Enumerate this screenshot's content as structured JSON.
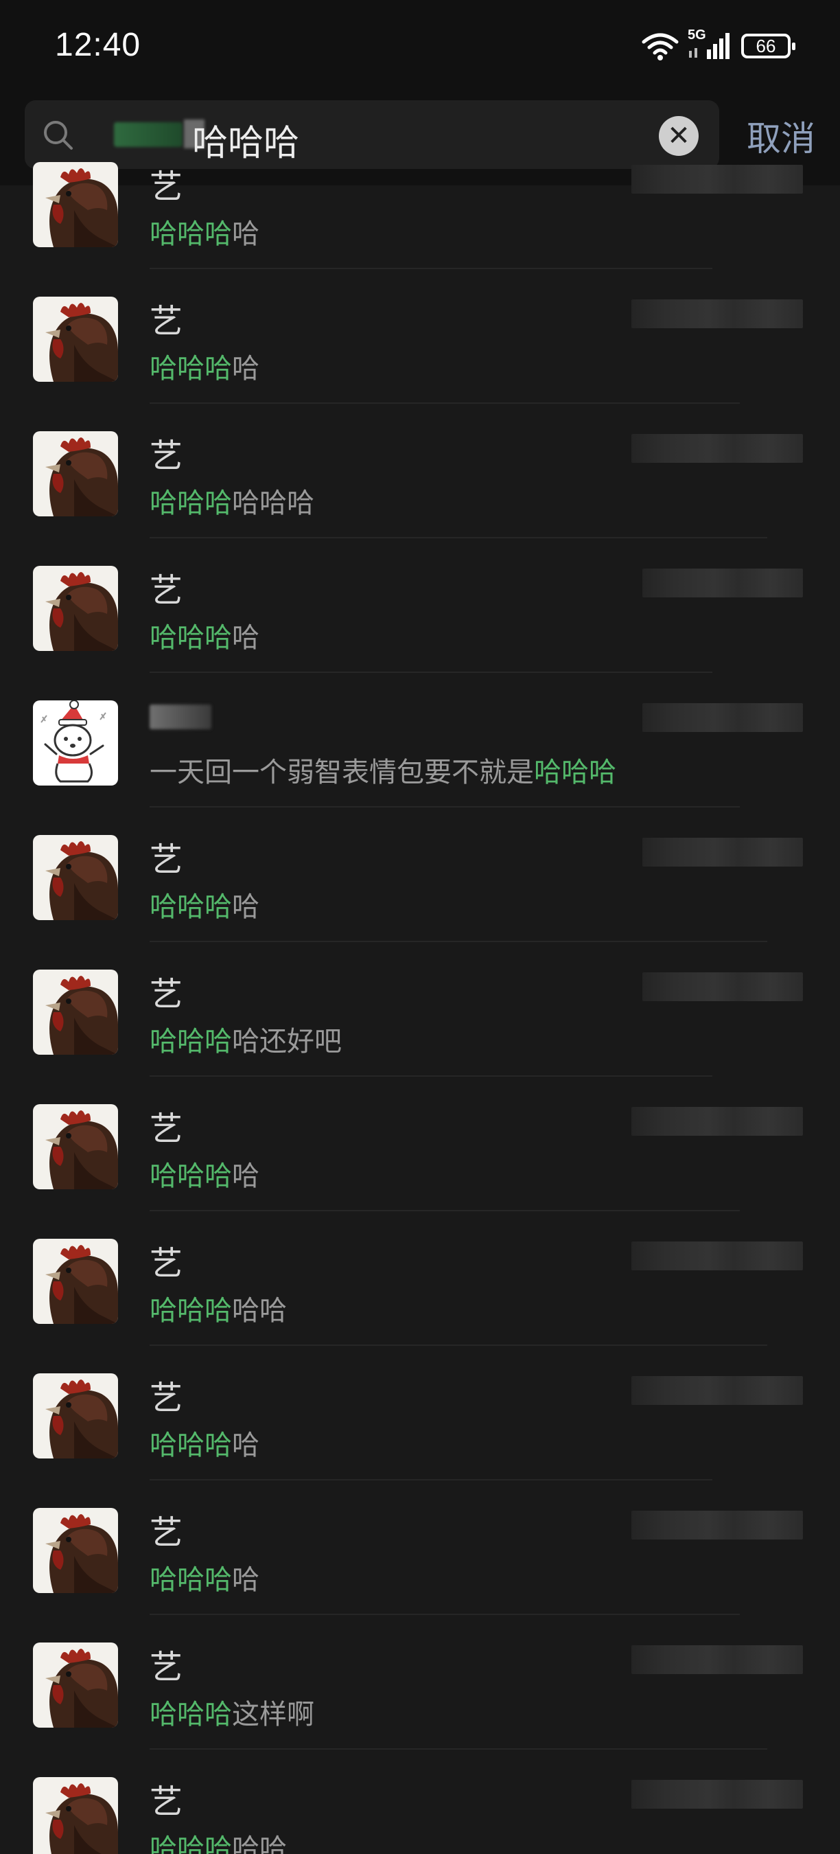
{
  "status_bar": {
    "time": "12:40",
    "network": "5G",
    "battery": "66"
  },
  "search": {
    "query": "哈哈哈",
    "cancel_label": "取消"
  },
  "results": [
    {
      "sender": "艺",
      "highlight": "哈哈哈",
      "rest": "哈"
    },
    {
      "sender": "艺",
      "highlight": "哈哈哈",
      "rest": "哈"
    },
    {
      "sender": "艺",
      "highlight": "哈哈哈",
      "rest": "哈哈哈"
    },
    {
      "sender": "艺",
      "highlight": "哈哈哈",
      "rest": "哈"
    },
    {
      "sender": "",
      "prefix": "一天回一个弱智表情包要不就是",
      "highlight": "哈哈哈",
      "rest": "",
      "avatar": "bear"
    },
    {
      "sender": "艺",
      "highlight": "哈哈哈",
      "rest": "哈"
    },
    {
      "sender": "艺",
      "highlight": "哈哈哈",
      "rest": "哈还好吧"
    },
    {
      "sender": "艺",
      "highlight": "哈哈哈",
      "rest": "哈"
    },
    {
      "sender": "艺",
      "highlight": "哈哈哈",
      "rest": "哈哈"
    },
    {
      "sender": "艺",
      "highlight": "哈哈哈",
      "rest": "哈"
    },
    {
      "sender": "艺",
      "highlight": "哈哈哈",
      "rest": "哈"
    },
    {
      "sender": "艺",
      "highlight": "哈哈哈",
      "rest": "这样啊"
    },
    {
      "sender": "艺",
      "highlight": "哈哈哈",
      "rest": "哈哈"
    }
  ],
  "colors": {
    "background": "#191919",
    "highlight": "#54b96b",
    "cancel": "#8fa0bc"
  },
  "icons": [
    "wifi-icon",
    "signal-icon",
    "battery-icon",
    "search-icon",
    "clear-icon"
  ]
}
